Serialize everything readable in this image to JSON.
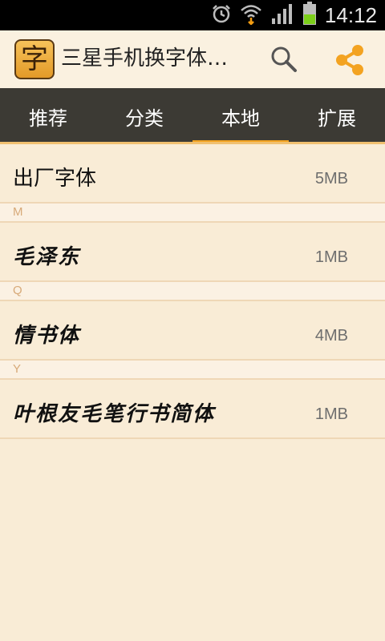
{
  "status_bar": {
    "time": "14:12",
    "icons": [
      "alarm-icon",
      "wifi-icon",
      "signal-icon",
      "battery-icon"
    ]
  },
  "app_bar": {
    "icon_glyph": "字",
    "title": "三星手机换字体…",
    "actions": [
      "search-icon",
      "share-icon"
    ]
  },
  "tabs": [
    {
      "label": "推荐",
      "active": false
    },
    {
      "label": "分类",
      "active": false
    },
    {
      "label": "本地",
      "active": true
    },
    {
      "label": "扩展",
      "active": false
    }
  ],
  "list": {
    "items": [
      {
        "name": "出厂字体",
        "size": "5MB"
      },
      {
        "section": "M"
      },
      {
        "name": "毛泽东",
        "size": "1MB"
      },
      {
        "section": "Q"
      },
      {
        "name": "情书体",
        "size": "4MB"
      },
      {
        "section": "Y"
      },
      {
        "name": "叶根友毛笔行书简体",
        "size": "1MB"
      }
    ]
  },
  "colors": {
    "background": "#f9ecd6",
    "tab_bar": "#3c3a34",
    "accent": "#f3a321",
    "divider": "#efd7b6",
    "section_letter": "#d7a978"
  }
}
